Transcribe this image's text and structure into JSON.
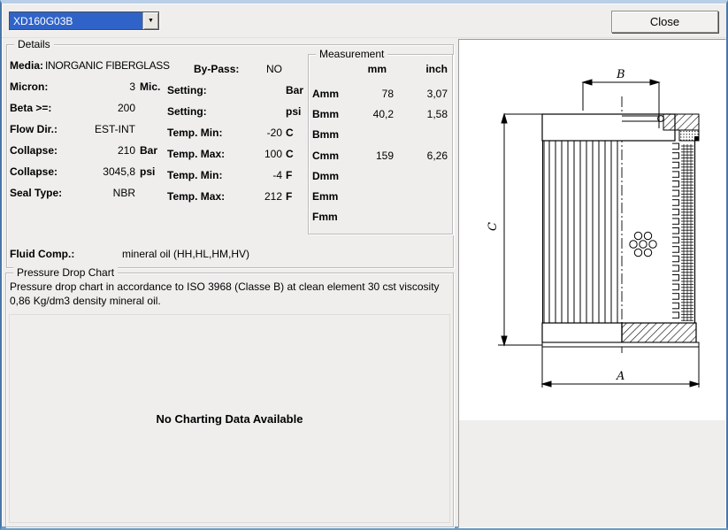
{
  "window": {
    "close_label": "Close"
  },
  "part_selector": {
    "value": "XD160G03B",
    "arrow": "▼"
  },
  "details": {
    "title": "Details",
    "left_rows": [
      {
        "label": "Media:",
        "value": "INORGANIC FIBERGLASS",
        "unit": ""
      },
      {
        "label": "Micron:",
        "value": "3",
        "unit": "Mic."
      },
      {
        "label": "Beta >=:",
        "value": "200",
        "unit": ""
      },
      {
        "label": "Flow Dir.:",
        "value": "EST-INT",
        "unit": ""
      },
      {
        "label": "Collapse:",
        "value": "210",
        "unit": "Bar"
      },
      {
        "label": "Collapse:",
        "value": "3045,8",
        "unit": "psi"
      },
      {
        "label": "Seal Type:",
        "value": "NBR",
        "unit": ""
      }
    ],
    "right_rows": [
      {
        "label": "By-Pass:",
        "value": "NO",
        "unit": ""
      },
      {
        "label": "Setting:",
        "value": "",
        "unit": "Bar"
      },
      {
        "label": "Setting:",
        "value": "",
        "unit": "psi"
      },
      {
        "label": "Temp. Min:",
        "value": "-20",
        "unit": "C"
      },
      {
        "label": "Temp. Max:",
        "value": "100",
        "unit": "C"
      },
      {
        "label": "Temp. Min:",
        "value": "-4",
        "unit": "F"
      },
      {
        "label": "Temp. Max:",
        "value": "212",
        "unit": "F"
      }
    ],
    "fluid_label": "Fluid Comp.:",
    "fluid_value": "mineral oil (HH,HL,HM,HV)"
  },
  "measurement": {
    "title": "Measurement",
    "col_mm": "mm",
    "col_inch": "inch",
    "rows": [
      {
        "label": "Amm",
        "mm": "78",
        "inch": "3,07"
      },
      {
        "label": "Bmm",
        "mm": "40,2",
        "inch": "1,58"
      },
      {
        "label": "Bmm",
        "mm": "",
        "inch": ""
      },
      {
        "label": "Cmm",
        "mm": "159",
        "inch": "6,26"
      },
      {
        "label": "Dmm",
        "mm": "",
        "inch": ""
      },
      {
        "label": "Emm",
        "mm": "",
        "inch": ""
      },
      {
        "label": "Fmm",
        "mm": "",
        "inch": ""
      }
    ]
  },
  "pressure_chart": {
    "title": "Pressure Drop Chart",
    "description": "Pressure drop chart in accordance to ISO 3968 (Classe B) at clean element 30 cst viscosity 0,86 Kg/dm3 density mineral oil.",
    "no_data": "No Charting Data Available"
  },
  "diagram": {
    "dim_a": "A",
    "dim_b": "B",
    "dim_c": "C"
  },
  "colors": {
    "selection_blue": "#2f63c8",
    "frame_blue": "#4a76a8"
  }
}
